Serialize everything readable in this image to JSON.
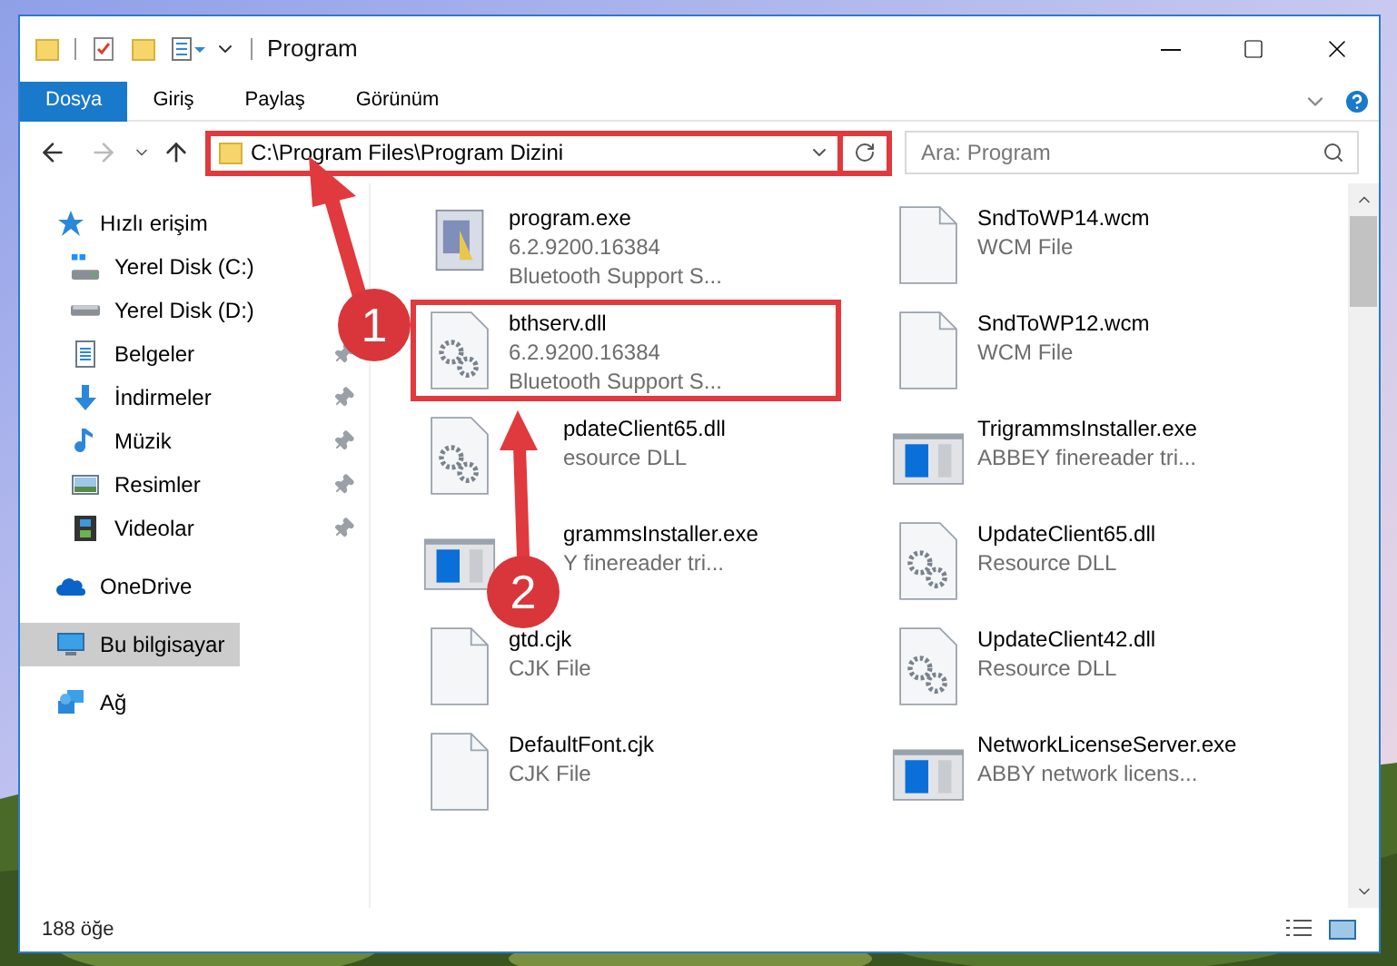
{
  "window": {
    "title": "Program"
  },
  "ribbon": {
    "tabs": [
      {
        "label": "Dosya",
        "selected": true
      },
      {
        "label": "Giriş",
        "selected": false
      },
      {
        "label": "Paylaş",
        "selected": false
      },
      {
        "label": "Görünüm",
        "selected": false
      }
    ]
  },
  "address": {
    "path": "C:\\Program Files\\Program Dizini",
    "highlighted": true
  },
  "search": {
    "placeholder": "Ara: Program"
  },
  "sidebar": {
    "items": [
      {
        "label": "Hızlı erişim",
        "kind": "star",
        "selected": false,
        "children": [
          {
            "label": "Yerel Disk (C:)",
            "kind": "drive-c",
            "pinned": false,
            "selected": false
          },
          {
            "label": "Yerel Disk (D:)",
            "kind": "drive",
            "pinned": false,
            "selected": false
          },
          {
            "label": "Belgeler",
            "kind": "docs",
            "pinned": true,
            "selected": false
          },
          {
            "label": "İndirmeler",
            "kind": "download",
            "pinned": true,
            "selected": false
          },
          {
            "label": "Müzik",
            "kind": "music",
            "pinned": true,
            "selected": false
          },
          {
            "label": "Resimler",
            "kind": "pictures",
            "pinned": true,
            "selected": false
          },
          {
            "label": "Videolar",
            "kind": "videos",
            "pinned": true,
            "selected": false
          }
        ]
      },
      {
        "label": "OneDrive",
        "kind": "cloud",
        "selected": false
      },
      {
        "label": "Bu bilgisayar",
        "kind": "computer",
        "selected": true
      },
      {
        "label": "Ağ",
        "kind": "network",
        "selected": false
      }
    ]
  },
  "files": [
    {
      "name": "program.exe",
      "lines": [
        "6.2.9200.16384",
        "Bluetooth Support S..."
      ],
      "kind": "app",
      "highlighted": false
    },
    {
      "name": "SndToWP14.wcm",
      "lines": [
        "WCM File"
      ],
      "kind": "blank",
      "highlighted": false
    },
    {
      "name": "bthserv.dll",
      "lines": [
        "6.2.9200.16384",
        "Bluetooth Support S..."
      ],
      "kind": "dll",
      "highlighted": true
    },
    {
      "name": "SndToWP12.wcm",
      "lines": [
        "WCM File"
      ],
      "kind": "blank",
      "highlighted": false
    },
    {
      "name": "pdateClient65.dll",
      "lines": [
        "esource DLL"
      ],
      "kind": "dll",
      "highlighted": false
    },
    {
      "name": "TrigrammsInstaller.exe",
      "lines": [
        "ABBEY finereader tri..."
      ],
      "kind": "installer",
      "highlighted": false
    },
    {
      "name": "grammsInstaller.exe",
      "lines": [
        "Y finereader tri..."
      ],
      "kind": "installer",
      "highlighted": false
    },
    {
      "name": "UpdateClient65.dll",
      "lines": [
        "Resource DLL"
      ],
      "kind": "dll",
      "highlighted": false
    },
    {
      "name": "gtd.cjk",
      "lines": [
        "CJK File"
      ],
      "kind": "blank",
      "highlighted": false
    },
    {
      "name": "UpdateClient42.dll",
      "lines": [
        "Resource DLL"
      ],
      "kind": "dll",
      "highlighted": false
    },
    {
      "name": "DefaultFont.cjk",
      "lines": [
        "CJK File"
      ],
      "kind": "blank",
      "highlighted": false
    },
    {
      "name": "NetworkLicenseServer.exe",
      "lines": [
        "ABBY network licens..."
      ],
      "kind": "installer",
      "highlighted": false
    }
  ],
  "status_bar": {
    "count": "188 öğe"
  },
  "annotations": [
    {
      "label": "1"
    },
    {
      "label": "2"
    }
  ]
}
